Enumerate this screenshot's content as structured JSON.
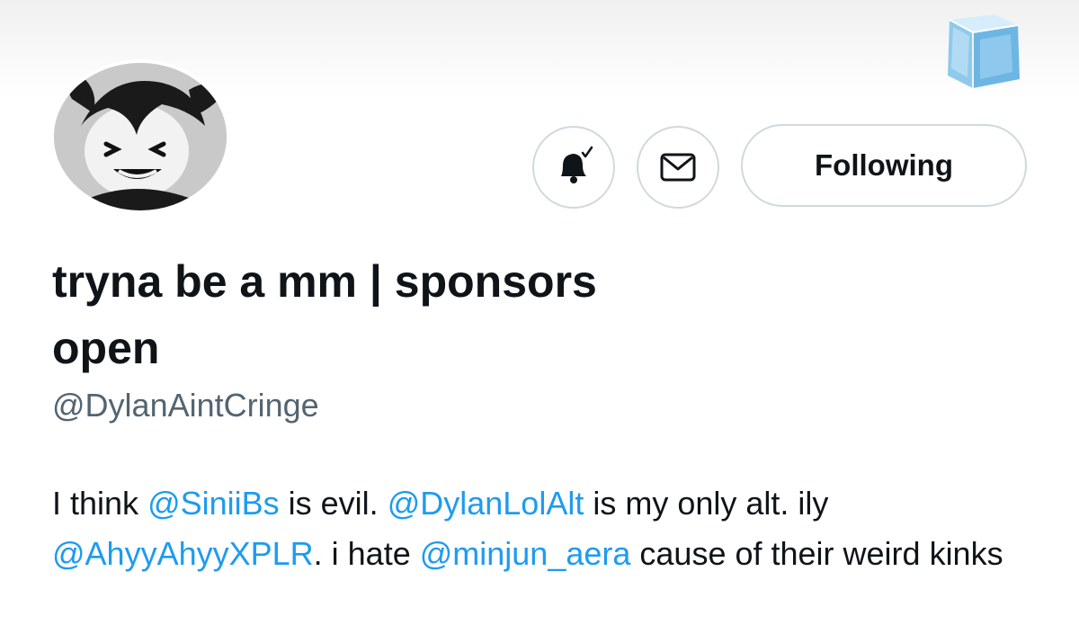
{
  "profile": {
    "display_name": "tryna be a mm | sponsors open",
    "handle": "@DylanAintCringe",
    "bio": {
      "t1": "I think ",
      "m1": "@SiniiBs",
      "t2": " is evil. ",
      "m2": "@DylanLolAlt",
      "t3": " is my only alt. ily ",
      "m3": "@AhyyAhyyXPLR",
      "t4": ". i hate ",
      "m4": "@minjun_aera",
      "t5": " cause of their weird kinks"
    }
  },
  "actions": {
    "notify_icon": "bell-check-icon",
    "message_icon": "mail-envelope-icon",
    "follow_label": "Following"
  },
  "decor": {
    "corner_icon": "ice-cube-icon"
  },
  "colors": {
    "link": "#1d9bf0",
    "text": "#0f1419",
    "secondary": "#536471",
    "border": "#cfd9de"
  }
}
